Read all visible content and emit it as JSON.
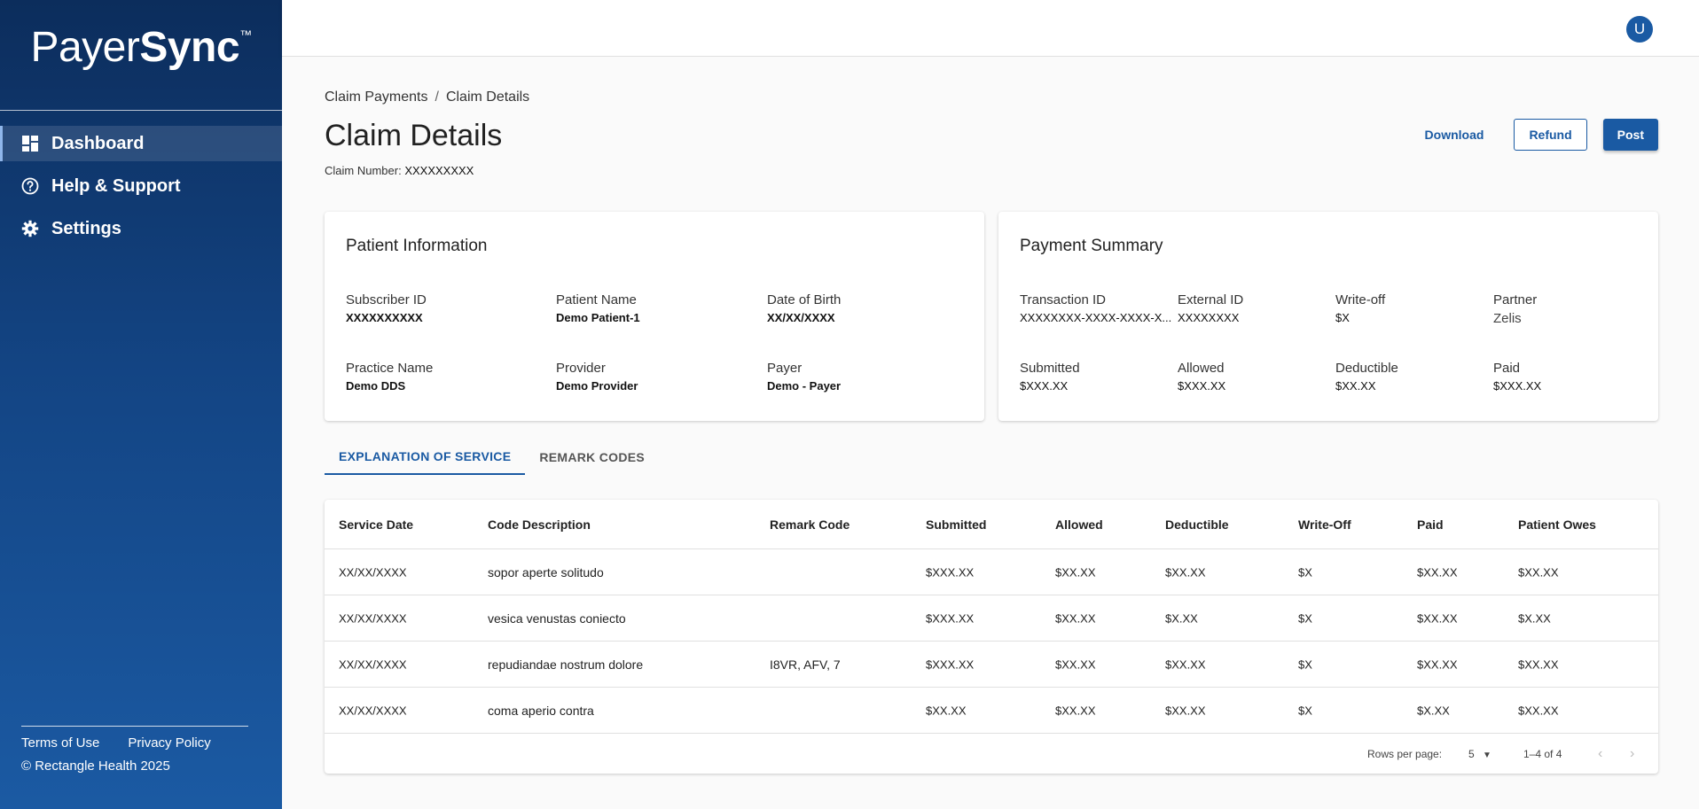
{
  "app": {
    "logo_light": "Payer",
    "logo_bold": "Sync",
    "logo_tm": "™"
  },
  "sidebar": {
    "items": [
      {
        "label": "Dashboard",
        "icon": "dashboard-icon",
        "active": true
      },
      {
        "label": "Help & Support",
        "icon": "help-circle-icon",
        "active": false
      },
      {
        "label": "Settings",
        "icon": "gear-icon",
        "active": false
      }
    ],
    "footer": {
      "terms": "Terms of Use",
      "privacy": "Privacy Policy",
      "copyright": "© Rectangle Health 2025"
    }
  },
  "header": {
    "avatar_initial": "U"
  },
  "breadcrumb": {
    "parent": "Claim Payments",
    "separator": "/",
    "current": "Claim Details"
  },
  "page": {
    "title": "Claim Details",
    "claim_number_label": "Claim Number:",
    "claim_number_value": "XXXXXXXXX"
  },
  "actions": {
    "download": "Download",
    "refund": "Refund",
    "post": "Post"
  },
  "patient_info": {
    "title": "Patient Information",
    "subscriber_id_label": "Subscriber ID",
    "subscriber_id": "XXXXXXXXXX",
    "patient_name_label": "Patient Name",
    "patient_name": "Demo Patient-1",
    "dob_label": "Date of Birth",
    "dob": "XX/XX/XXXX",
    "practice_label": "Practice Name",
    "practice": "Demo DDS",
    "provider_label": "Provider",
    "provider": "Demo Provider",
    "payer_label": "Payer",
    "payer": "Demo - Payer"
  },
  "payment_summary": {
    "title": "Payment Summary",
    "transaction_id_label": "Transaction ID",
    "transaction_id": "XXXXXXXX-XXXX-XXXX-X...",
    "external_id_label": "External ID",
    "external_id": "XXXXXXXX",
    "writeoff_label": "Write-off",
    "writeoff": "$X",
    "partner_label": "Partner",
    "partner": "Zelis",
    "submitted_label": "Submitted",
    "submitted": "$XXX.XX",
    "allowed_label": "Allowed",
    "allowed": "$XXX.XX",
    "deductible_label": "Deductible",
    "deductible": "$XX.XX",
    "paid_label": "Paid",
    "paid": "$XXX.XX"
  },
  "tabs": [
    {
      "label": "EXPLANATION OF SERVICE",
      "active": true
    },
    {
      "label": "REMARK CODES",
      "active": false
    }
  ],
  "table": {
    "columns": [
      "Service Date",
      "Code Description",
      "Remark Code",
      "Submitted",
      "Allowed",
      "Deductible",
      "Write-Off",
      "Paid",
      "Patient Owes"
    ],
    "rows": [
      [
        "XX/XX/XXXX",
        "sopor aperte solitudo",
        "",
        "$XXX.XX",
        "$XX.XX",
        "$XX.XX",
        "$X",
        "$XX.XX",
        "$XX.XX"
      ],
      [
        "XX/XX/XXXX",
        "vesica venustas coniecto",
        "",
        "$XXX.XX",
        "$XX.XX",
        "$X.XX",
        "$X",
        "$XX.XX",
        "$X.XX"
      ],
      [
        "XX/XX/XXXX",
        "repudiandae nostrum dolore",
        "I8VR, AFV, 7",
        "$XXX.XX",
        "$XX.XX",
        "$XX.XX",
        "$X",
        "$XX.XX",
        "$XX.XX"
      ],
      [
        "XX/XX/XXXX",
        "coma aperio contra",
        "",
        "$XX.XX",
        "$XX.XX",
        "$XX.XX",
        "$X",
        "$X.XX",
        "$XX.XX"
      ]
    ],
    "pagination": {
      "rows_per_page_label": "Rows per page:",
      "rows_per_page": "5",
      "range": "1–4 of 4"
    }
  },
  "colors": {
    "brand": "#1a5aa3",
    "sidebar_top": "#0c2d5c",
    "sidebar_bottom": "#1b5aa3"
  }
}
